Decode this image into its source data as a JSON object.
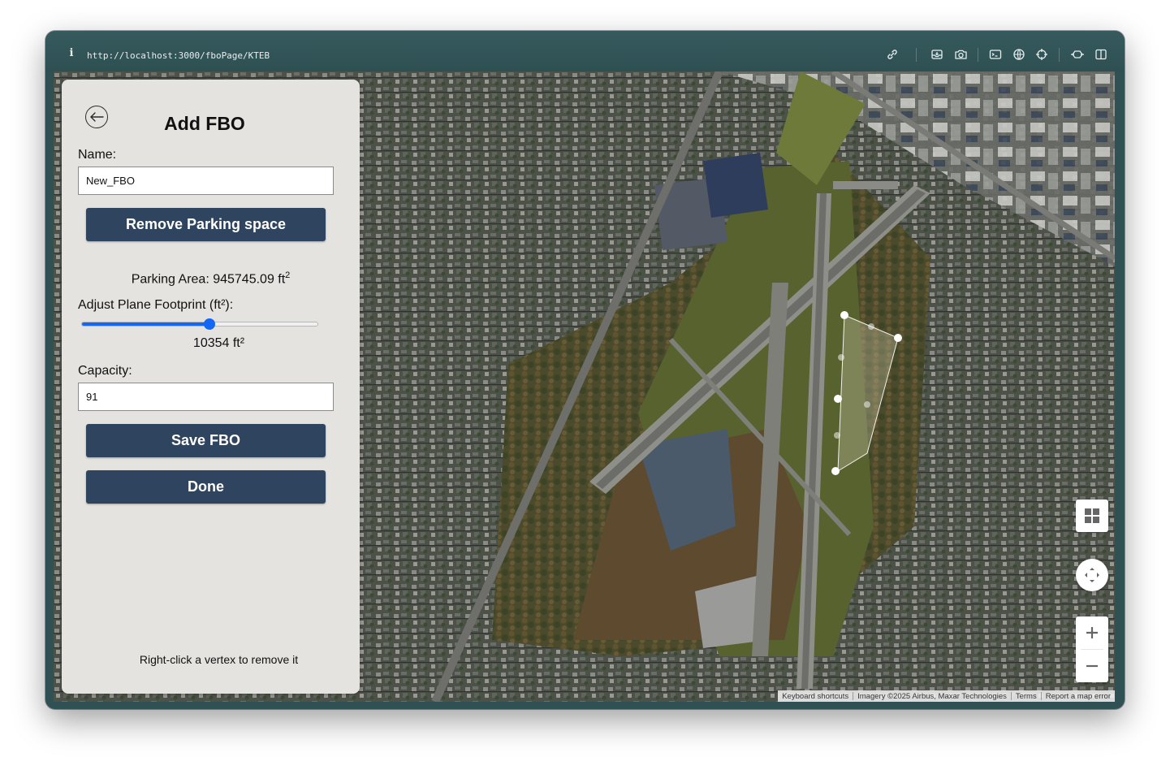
{
  "browser": {
    "url": "http://localhost:3000/fboPage/KTEB",
    "toolbar_icons": [
      "info-icon",
      "link-icon",
      "inbox-icon",
      "camera-icon",
      "terminal-icon",
      "globe-icon",
      "crosshair-icon",
      "extensions-icon",
      "sidebar-icon"
    ]
  },
  "panel": {
    "title": "Add FBO",
    "name_label": "Name:",
    "name_value": "New_FBO",
    "remove_parking_label": "Remove Parking space",
    "parking_area_text": "Parking Area: 945745.09 ft",
    "parking_area_sup": "2",
    "footprint_label": "Adjust Plane Footprint (ft²):",
    "footprint_slider_fraction": 0.54,
    "footprint_value": "10354 ft²",
    "capacity_label": "Capacity:",
    "capacity_value": "91",
    "save_label": "Save FBO",
    "done_label": "Done",
    "hint": "Right-click a vertex to remove it"
  },
  "map": {
    "attribution": {
      "keyboard": "Keyboard shortcuts",
      "imagery": "Imagery ©2025 Airbus, Maxar Technologies",
      "terms": "Terms",
      "report": "Report a map error"
    },
    "controls": [
      "map-type-icon",
      "camera-control-icon",
      "zoom-in-icon",
      "zoom-out-icon"
    ]
  },
  "colors": {
    "frame": "#2f5154",
    "panel_bg": "#e5e3df",
    "button_bg": "#2f455f",
    "slider_accent": "#1467f5"
  }
}
